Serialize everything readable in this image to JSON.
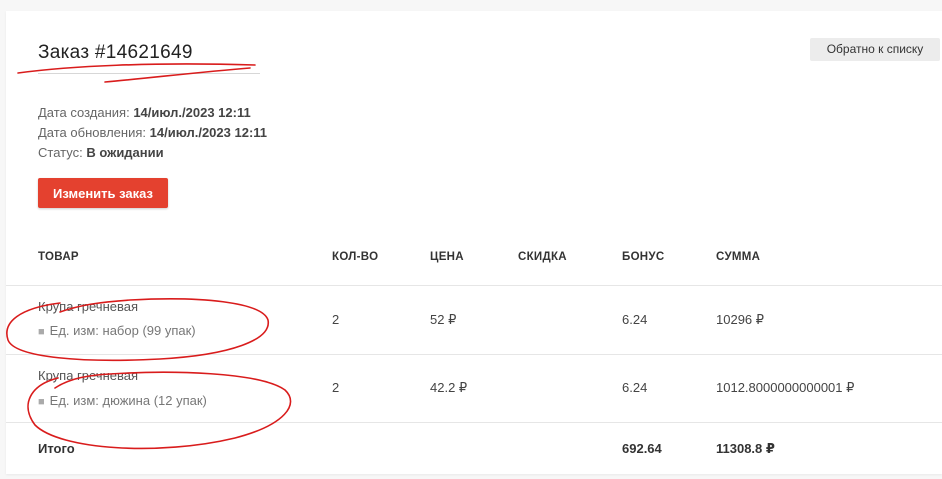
{
  "order": {
    "title": "Заказ #14621649",
    "created_label": "Дата создания: ",
    "created_value": "14/июл./2023 12:11",
    "updated_label": "Дата обновления: ",
    "updated_value": "14/июл./2023 12:11",
    "status_label": "Статус: ",
    "status_value": "В ожидании"
  },
  "buttons": {
    "back": "Обратно к списку",
    "edit": "Изменить заказ"
  },
  "table": {
    "headers": [
      "ТОВАР",
      "КОЛ-ВО",
      "ЦЕНА",
      "СКИДКА",
      "БОНУС",
      "СУММА"
    ],
    "rows": [
      {
        "name": "Крупа гречневая",
        "variant": "Ед. изм: набор (99 упак)",
        "qty": "2",
        "price": "52 ₽",
        "discount": "",
        "bonus": "6.24",
        "sum": "10296 ₽"
      },
      {
        "name": "Крупа гречневая",
        "variant": "Ед. изм: дюжина (12 упак)",
        "qty": "2",
        "price": "42.2 ₽",
        "discount": "",
        "bonus": "6.24",
        "sum": "1012.8000000000001 ₽"
      }
    ],
    "total": {
      "label": "Итого",
      "bonus": "692.64",
      "sum": "11308.8 ₽"
    }
  },
  "colors": {
    "accent": "#e4412f",
    "annotation": "#d91c1c"
  }
}
